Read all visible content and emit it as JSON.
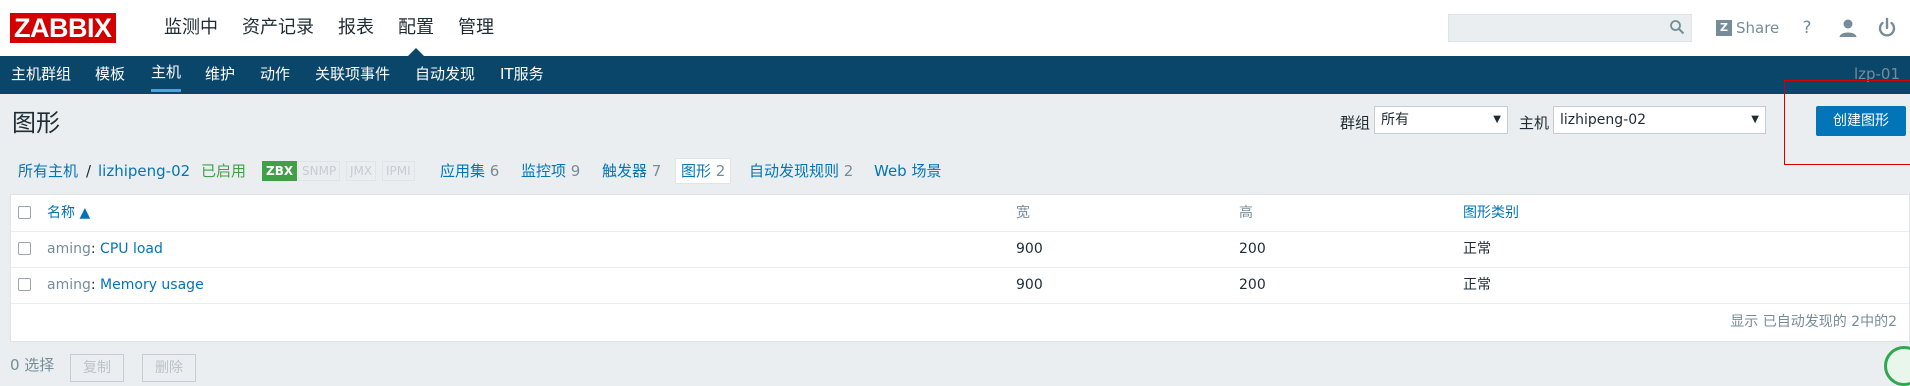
{
  "header": {
    "logo_text": "ZABBIX",
    "menu": [
      "监测中",
      "资产记录",
      "报表",
      "配置",
      "管理"
    ],
    "active_menu": "配置",
    "search_placeholder": "",
    "share_label": "Share",
    "share_badge": "Z",
    "help_label": "?"
  },
  "subnav": {
    "items": [
      "主机群组",
      "模板",
      "主机",
      "维护",
      "动作",
      "关联项事件",
      "自动发现",
      "IT服务"
    ],
    "active": "主机",
    "right_text": "lzp-01"
  },
  "page": {
    "title": "图形",
    "group_label": "群组",
    "group_value": "所有",
    "host_label": "主机",
    "host_value": "lizhipeng-02",
    "create_button": "创建图形"
  },
  "host_nav": {
    "all_hosts": "所有主机",
    "separator": "/",
    "host": "lizhipeng-02",
    "status": "已启用",
    "availability": [
      "ZBX",
      "SNMP",
      "JMX",
      "IPMI"
    ],
    "tabs": [
      {
        "label": "应用集",
        "count": "6"
      },
      {
        "label": "监控项",
        "count": "9"
      },
      {
        "label": "触发器",
        "count": "7"
      },
      {
        "label": "图形",
        "count": "2"
      },
      {
        "label": "自动发现规则",
        "count": "2"
      },
      {
        "label": "Web 场景",
        "count": ""
      }
    ]
  },
  "table": {
    "columns": [
      "名称 ▲",
      "宽",
      "高",
      "图形类别"
    ],
    "rows": [
      {
        "template": "aming",
        "name": "CPU load",
        "width": "900",
        "height": "200",
        "type": "正常"
      },
      {
        "template": "aming",
        "name": "Memory usage",
        "width": "900",
        "height": "200",
        "type": "正常"
      }
    ],
    "summary": "显示 已自动发现的 2中的2"
  },
  "footer": {
    "selected": "0 选择",
    "copy_button": "复制",
    "delete_button": "删除"
  }
}
